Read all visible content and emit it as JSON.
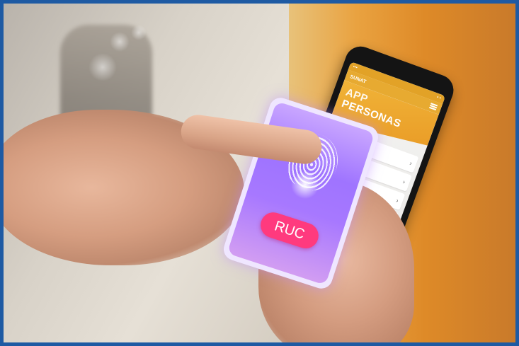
{
  "phone_app": {
    "status_left": "•••",
    "status_right": "▪ ▪",
    "brand": "SUNAT",
    "title_line1": "APP",
    "title_line2": "PERSONAS",
    "row_chevron": "›"
  },
  "overlay": {
    "button_label": "RUC"
  },
  "colors": {
    "frame_blue": "#1e5aa3",
    "frame_gold": "#d9b43a",
    "app_orange": "#e7aa31",
    "overlay_purple": "#a778ff",
    "button_pink": "#ff3a7e"
  }
}
